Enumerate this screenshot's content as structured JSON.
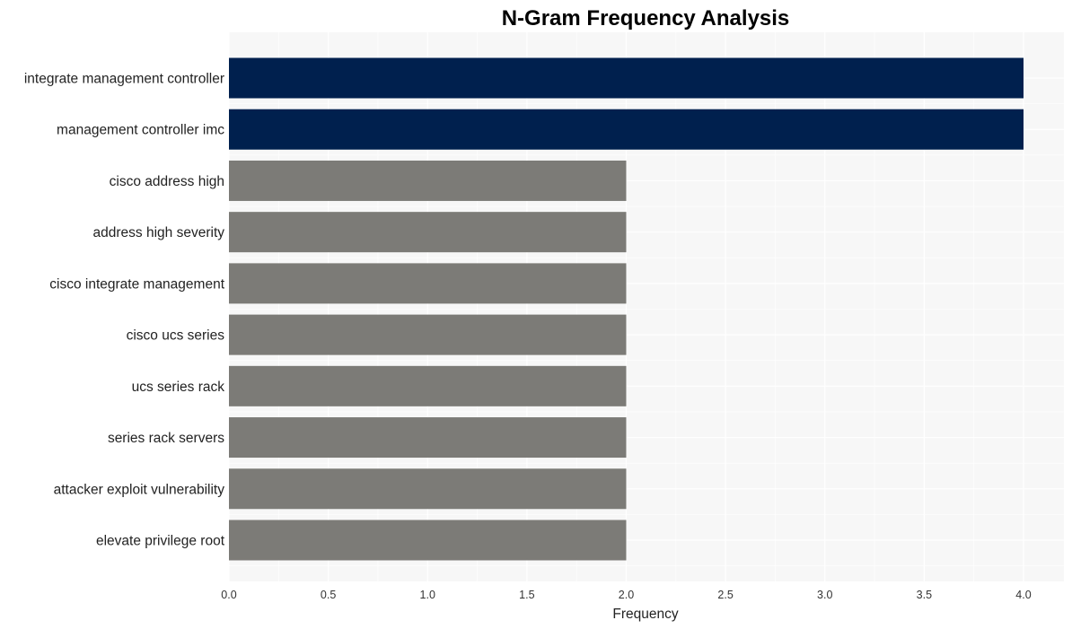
{
  "chart_data": {
    "type": "bar",
    "orientation": "horizontal",
    "title": "N-Gram Frequency Analysis",
    "xlabel": "Frequency",
    "ylabel": "",
    "xlim": [
      0,
      4.2
    ],
    "xticks": [
      0.0,
      0.5,
      1.0,
      1.5,
      2.0,
      2.5,
      3.0,
      3.5,
      4.0
    ],
    "xtick_labels": [
      "0.0",
      "0.5",
      "1.0",
      "1.5",
      "2.0",
      "2.5",
      "3.0",
      "3.5",
      "4.0"
    ],
    "grid": true,
    "legend": "none",
    "categories": [
      "integrate management controller",
      "management controller imc",
      "cisco address high",
      "address high severity",
      "cisco integrate management",
      "cisco ucs series",
      "ucs series rack",
      "series rack servers",
      "attacker exploit vulnerability",
      "elevate privilege root"
    ],
    "values": [
      4,
      4,
      2,
      2,
      2,
      2,
      2,
      2,
      2,
      2
    ],
    "colors": {
      "top": "#00204e",
      "other": "#7c7b77",
      "plot_background": "#f7f7f7",
      "grid": "#ffffff"
    }
  }
}
